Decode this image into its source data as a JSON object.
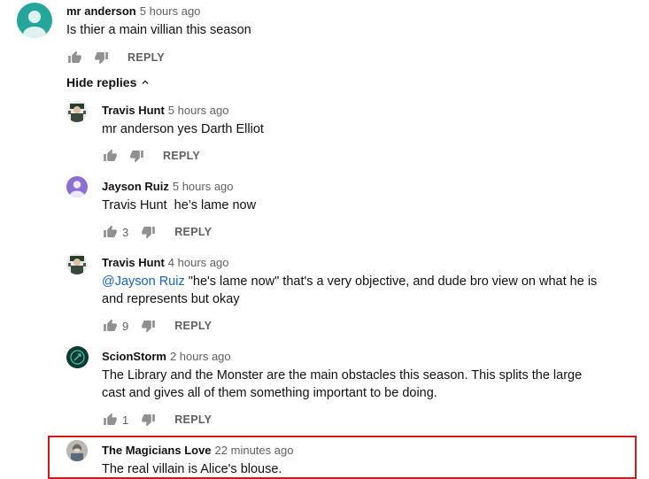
{
  "parent": {
    "author": "mr anderson",
    "time": "5 hours ago",
    "text": "Is thier a main villian this season",
    "reply_label": "REPLY",
    "avatar_color": "#26a69a"
  },
  "hide_replies_label": "Hide replies",
  "replies": [
    {
      "author": "Travis Hunt",
      "time": "5 hours ago",
      "text": "mr anderson yes Darth Elliot",
      "likes": "",
      "reply_label": "REPLY"
    },
    {
      "author": "Jayson Ruiz",
      "time": "5 hours ago",
      "text": "Travis Hunt  he’s lame now",
      "likes": "3",
      "reply_label": "REPLY",
      "avatar_color": "#8c6fd1"
    },
    {
      "author": "Travis Hunt",
      "time": "4 hours ago",
      "mention": "@Jayson Ruiz",
      "text": " \"he's lame now\" that's a very objective, and dude bro view on what he is and represents but okay",
      "likes": "9",
      "reply_label": "REPLY"
    },
    {
      "author": "ScionStorm",
      "time": "2 hours ago",
      "text": "The Library and the Monster are the main obstacles this season.  This splits the large cast and gives all of them something important to be doing.",
      "likes": "1",
      "reply_label": "REPLY"
    },
    {
      "author": "The Magicians Love",
      "time": "22 minutes ago",
      "text": "The real villain is Alice's blouse."
    }
  ],
  "colors": {
    "link": "#1565c0",
    "highlight_border": "#d11a1a",
    "meta_gray": "#606060",
    "icon_gray": "#909090"
  },
  "icons": [
    "thumb-up-icon",
    "thumb-down-icon",
    "chevron-up-icon"
  ]
}
